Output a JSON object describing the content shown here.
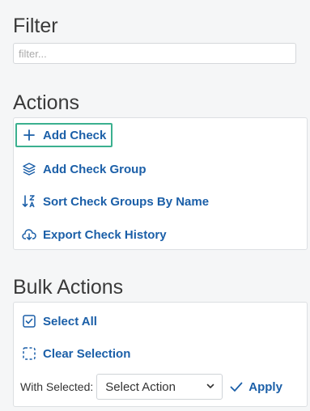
{
  "filter": {
    "title": "Filter",
    "placeholder": "filter..."
  },
  "actions": {
    "title": "Actions",
    "items": [
      {
        "label": "Add Check",
        "icon": "plus-icon"
      },
      {
        "label": "Add Check Group",
        "icon": "layers-icon"
      },
      {
        "label": "Sort Check Groups By Name",
        "icon": "sort-az-icon"
      },
      {
        "label": "Export Check History",
        "icon": "cloud-download-icon"
      }
    ]
  },
  "bulk_actions": {
    "title": "Bulk Actions",
    "select_all": "Select All",
    "clear_selection": "Clear Selection",
    "with_selected_label": "With Selected:",
    "select_value": "Select Action",
    "apply_label": "Apply"
  },
  "colors": {
    "link": "#1b5fa8",
    "highlight": "#3bb08f"
  }
}
